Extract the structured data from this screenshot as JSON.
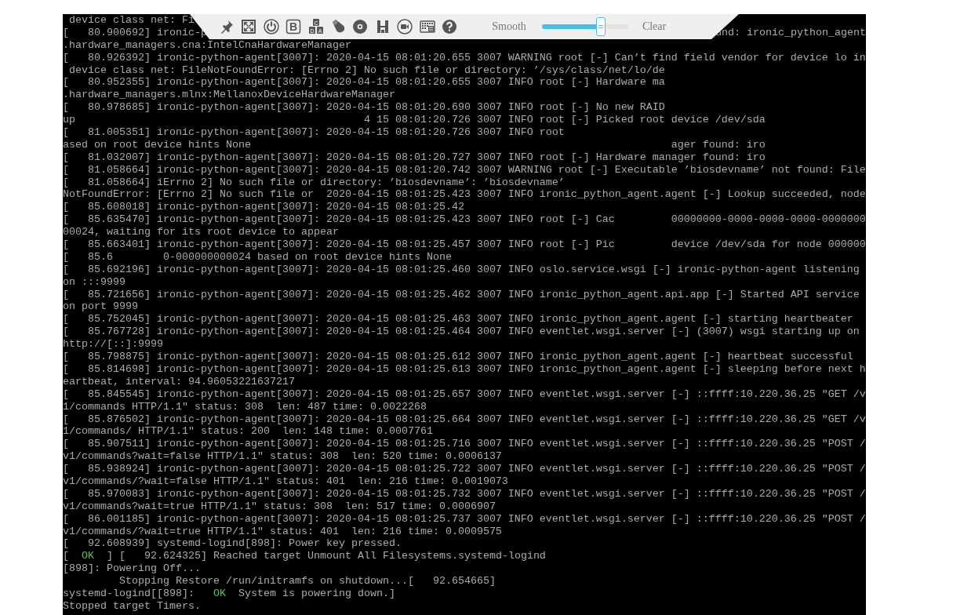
{
  "toolbar": {
    "buttons": [
      {
        "kind": "pin"
      },
      {
        "kind": "fullscreen"
      },
      {
        "kind": "power"
      },
      {
        "kind": "letter",
        "label": "B"
      },
      {
        "kind": "keys",
        "labels": [
          "C",
          "D",
          "A"
        ]
      },
      {
        "kind": "mouse"
      },
      {
        "kind": "disc"
      },
      {
        "kind": "save"
      },
      {
        "kind": "record"
      },
      {
        "kind": "keyboard"
      },
      {
        "kind": "help"
      }
    ],
    "slider": {
      "left_label": "Smooth",
      "right_label": "Clear",
      "level": 0.68
    }
  },
  "console": {
    "lines": [
      " device class net: Fi",
      {
        "parts": [
          {
            "kind": "plain",
            "text": "[   80.900692] ironic-p"
          },
          {
            "kind": "right",
            "text": "und: ironic_python_agent"
          }
        ]
      },
      ".hardware_managers.cna:IntelCnaHardwareManager",
      "[   80.926392] ironic-python-agent[3007]: 2020-04-15 08:01:20.655 3007 WARNING root [-] Can’t find field vendor for device lo in",
      " device class net: FileNotFoundError: [Errno 2] No such file or directory: ’/sys/class/net/lo/de",
      "[   80.952355] ironic-python-agent[3007]: 2020-04-15 08:01:20.655 3007 INFO root [-] Hardware ma",
      ".hardware_managers.mlnx:MellanoxDeviceHardwareManager",
      "[   80.978685] ironic-python-agent[3007]: 2020-04-15 08:01:20.690 3007 INFO root [-] No new RAID",
      "up                                              4 15 08:01:20.726 3007 INFO root [-] Picked root device /dev/sda",
      "[   81.005351] ironic-python-agent[3007]: 2020-04-15 08:01:20.726 3007 INFO root",
      "ased on root device hints None                                                                   ager found: iro",
      "[   81.032007] ironic-python-agent[3007]: 2020-04-15 08:01:20.727 3007 INFO root [-] Hardware manager found: iro",
      "[   81.058664] ironic-python-agent[3007]: 2020-04-15 08:01:20.742 3007 WARNING root [-] Executable ’biosdevname’ not found: File",
      "[   81.058664] iErrno 2] No such file or directory: ’biosdevname’: ’biosdevname’",
      "NotFoundError: [Errno 2] No such file or  2020-04-15 08:01:25.423 3007 INFO ironic_python_agent.agent [-] Lookup succeeded, node",
      "[   85.608018] ironic-python-agent[3007]: 2020-04-15 08:01:25.42",
      "[   85.635470] ironic-python-agent[3007]: 2020-04-15 08:01:25.423 3007 INFO root [-] Cac         00000000-0000-0000-0000-0000000",
      "00024, waiting for its root device to appear",
      "[   85.663401] ironic-python-agent[3007]: 2020-04-15 08:01:25.457 3007 INFO root [-] Pic         device /dev/sda for node 000000",
      "[   85.6        0-000000000024 based on root device hints None",
      "[   85.692196] ironic-python-agent[3007]: 2020-04-15 08:01:25.460 3007 INFO oslo.service.wsgi [-] ironic-python-agent listening",
      "on :::9999",
      "[   85.721656] ironic-python-agent[3007]: 2020-04-15 08:01:25.462 3007 INFO ironic_python_agent.api.app [-] Started API service",
      "on port 9999",
      "[   85.752045] ironic-python-agent[3007]: 2020-04-15 08:01:25.463 3007 INFO ironic_python_agent.agent [-] starting heartbeater",
      "[   85.767728] ironic-python-agent[3007]: 2020-04-15 08:01:25.464 3007 INFO eventlet.wsgi.server [-] (3007) wsgi starting up on",
      "http://[::]:9999",
      "[   85.798875] ironic-python-agent[3007]: 2020-04-15 08:01:25.612 3007 INFO ironic_python_agent.agent [-] heartbeat successful",
      "[   85.814698] ironic-python-agent[3007]: 2020-04-15 08:01:25.613 3007 INFO ironic_python_agent.agent [-] sleeping before next h",
      "eartbeat, interval: 94.96053221637217",
      "[   85.845545] ironic-python-agent[3007]: 2020-04-15 08:01:25.657 3007 INFO eventlet.wsgi.server [-] ::ffff:10.220.36.25 \"GET /v",
      "1/commands HTTP/1.1\" status: 308  len: 487 time: 0.0022268",
      "[   85.876502] ironic-python-agent[3007]: 2020-04-15 08:01:25.664 3007 INFO eventlet.wsgi.server [-] ::ffff:10.220.36.25 \"GET /v",
      "1/commands/ HTTP/1.1\" status: 200  len: 148 time: 0.0007761",
      "[   85.907511] ironic-python-agent[3007]: 2020-04-15 08:01:25.716 3007 INFO eventlet.wsgi.server [-] ::ffff:10.220.36.25 \"POST /",
      "v1/commands?wait=false HTTP/1.1\" status: 308  len: 520 time: 0.0006137",
      "[   85.938924] ironic-python-agent[3007]: 2020-04-15 08:01:25.722 3007 INFO eventlet.wsgi.server [-] ::ffff:10.220.36.25 \"POST /",
      "v1/commands/?wait=false HTTP/1.1\" status: 401  len: 216 time: 0.0019073",
      "[   85.970083] ironic-python-agent[3007]: 2020-04-15 08:01:25.732 3007 INFO eventlet.wsgi.server [-] ::ffff:10.220.36.25 \"POST /",
      "v1/commands?wait=true HTTP/1.1\" status: 308  len: 517 time: 0.0006907",
      "[   86.001185] ironic-python-agent[3007]: 2020-04-15 08:01:25.737 3007 INFO eventlet.wsgi.server [-] ::ffff:10.220.36.25 \"POST /",
      "v1/commands/?wait=true HTTP/1.1\" status: 401  len: 216 time: 0.0009575",
      "[   92.608939] systemd-logind[898]: Power key pressed.",
      {
        "parts": [
          {
            "kind": "plain",
            "text": "["
          },
          {
            "kind": "ok",
            "text": "OK"
          },
          {
            "kind": "plain",
            "text": "] [   92.624325] Reached target Unmount All Filesystems.systemd-logind"
          }
        ]
      },
      "[898]: Powering Off...",
      "         Stopping Restore /run/initramfs on shutdown...[   92.654665]",
      {
        "parts": [
          {
            "kind": "plain",
            "text": "systemd-logind[[898]:"
          },
          {
            "kind": "ok",
            "text": "OK"
          },
          {
            "kind": "plain",
            "text": "System is powering down.]"
          }
        ]
      },
      "Stopped target Timers."
    ]
  }
}
